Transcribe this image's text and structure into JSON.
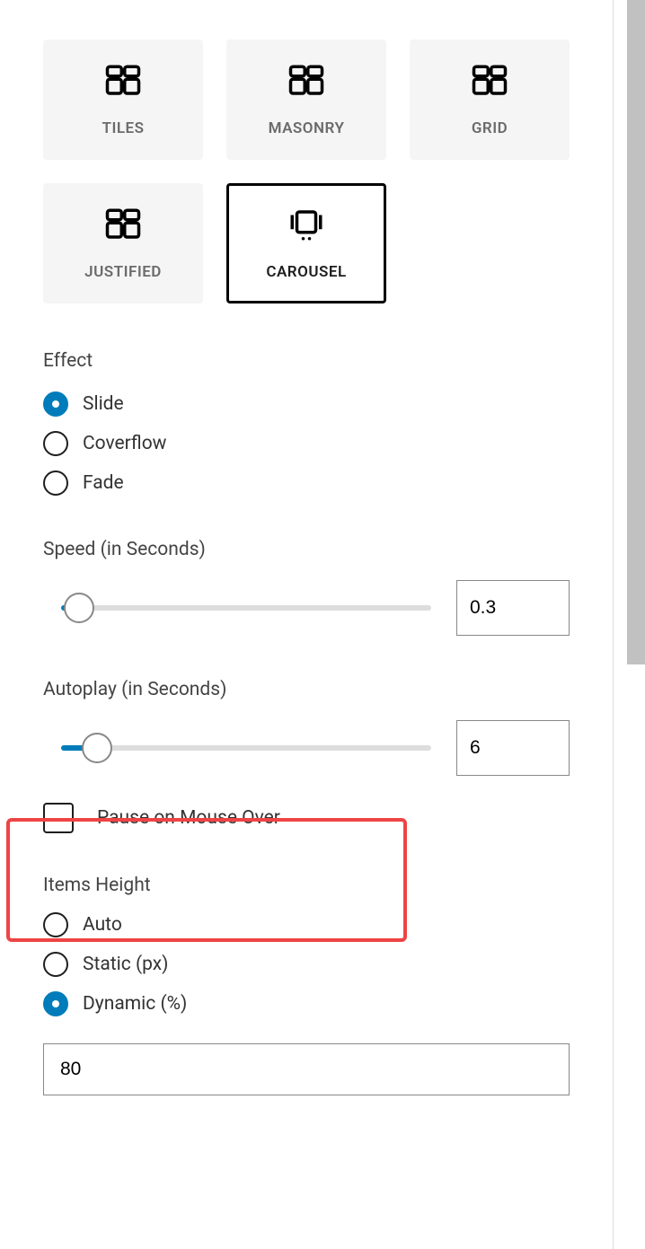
{
  "layouts": {
    "tiles": "TILES",
    "masonry": "MASONRY",
    "grid": "GRID",
    "justified": "JUSTIFIED",
    "carousel": "CAROUSEL"
  },
  "effect": {
    "label": "Effect",
    "options": {
      "slide": "Slide",
      "coverflow": "Coverflow",
      "fade": "Fade"
    },
    "selected": "slide"
  },
  "speed": {
    "label": "Speed (in Seconds)",
    "value": "0.3"
  },
  "autoplay": {
    "label": "Autoplay (in Seconds)",
    "value": "6"
  },
  "pause": {
    "label": "Pause on Mouse Over",
    "checked": false
  },
  "items_height": {
    "label": "Items Height",
    "options": {
      "auto": "Auto",
      "static": "Static (px)",
      "dynamic": "Dynamic (%)"
    },
    "selected": "dynamic",
    "value": "80"
  }
}
